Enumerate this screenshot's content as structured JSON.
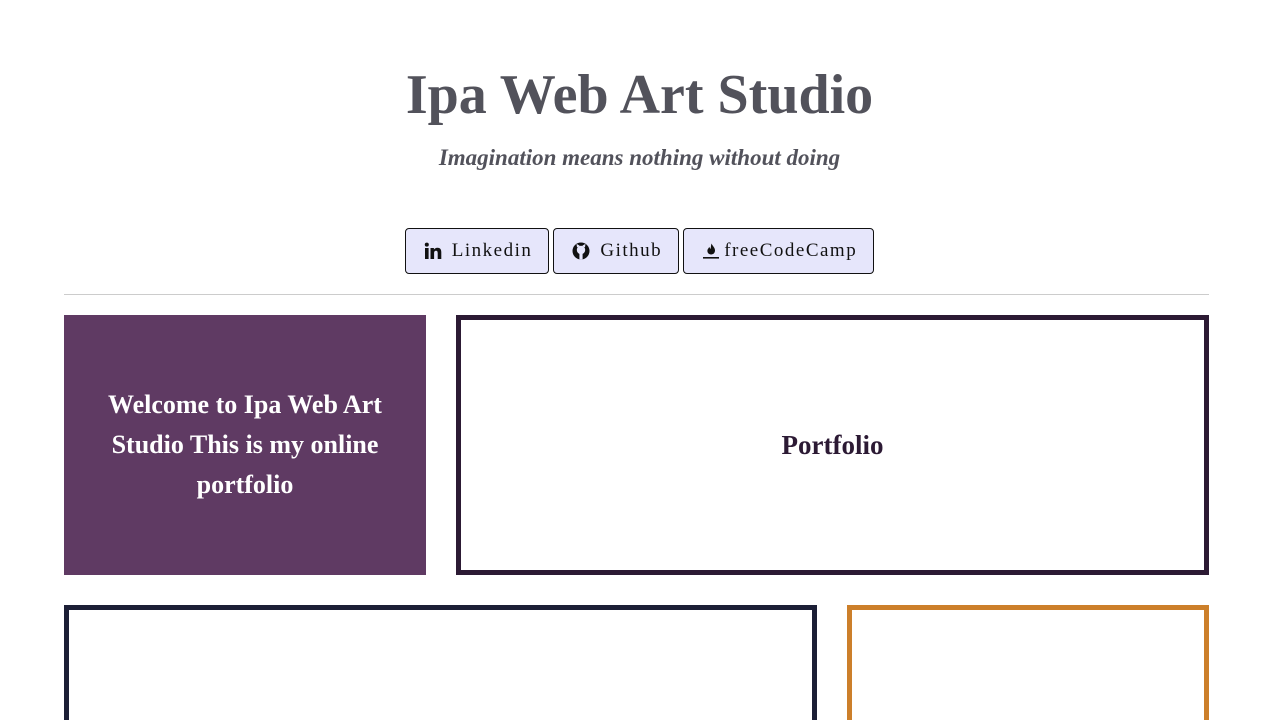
{
  "header": {
    "title": "Ipa Web Art Studio",
    "subtitle": "Imagination means nothing without doing"
  },
  "links": [
    {
      "label": "Linkedin",
      "icon": "linkedin-icon"
    },
    {
      "label": "Github",
      "icon": "github-icon"
    },
    {
      "label": "freeCodeCamp",
      "icon": "freecodecamp-icon"
    }
  ],
  "welcome": {
    "text": "Welcome to Ipa Web Art Studio This is my online portfolio"
  },
  "portfolio": {
    "title": "Portfolio"
  },
  "colors": {
    "heading": "#52525b",
    "button_bg": "#e6e6fb",
    "welcome_bg": "#5f3a63",
    "portfolio_border": "#2c1a34",
    "navy_border": "#1c1f36",
    "orange_border": "#cc7f2a"
  }
}
